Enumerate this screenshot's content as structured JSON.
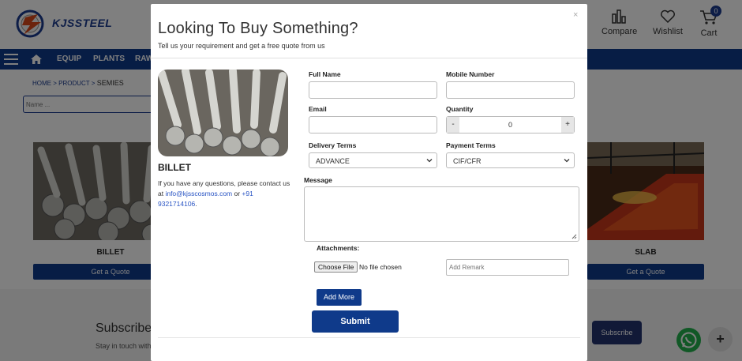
{
  "header": {
    "logo_text": "KJSSTEEL",
    "compare_label": "Compare",
    "wishlist_label": "Wishlist",
    "cart_label": "Cart",
    "cart_count": "0"
  },
  "nav": {
    "items": [
      "EQUIP",
      "PLANTS",
      "RAW"
    ]
  },
  "breadcrumb": {
    "home": "HOME",
    "product": "PRODUCT",
    "sep": ">",
    "current": "SEMIES"
  },
  "search": {
    "placeholder": "Name ..."
  },
  "products": [
    {
      "name": "BILLET",
      "cta": "Get a Quote"
    },
    {
      "name": "SLAB",
      "cta": "Get a Quote"
    }
  ],
  "footer": {
    "subscribe_title": "Subscribe",
    "subscribe_sub": "Stay in touch with",
    "subscribe_button": "Subscribe",
    "fab_plus": "+"
  },
  "modal": {
    "close": "×",
    "title": "Looking To Buy Something?",
    "subtitle": "Tell us your requirement and get a free quote from us",
    "product_name": "BILLET",
    "help_text_before": "If you have any questions, please contact us at ",
    "help_email": "info@kjsscosmos.com",
    "help_or": " or ",
    "help_phone": "+91 9321714106",
    "help_end": ".",
    "fields": {
      "full_name_label": "Full Name",
      "mobile_label": "Mobile Number",
      "email_label": "Email",
      "quantity_label": "Quantity",
      "quantity_value": "0",
      "qty_minus": "-",
      "qty_plus": "+",
      "delivery_label": "Delivery Terms",
      "delivery_value": "ADVANCE",
      "payment_label": "Payment Terms",
      "payment_value": "CIF/CFR",
      "message_label": "Message",
      "attachments_label": "Attachments:",
      "choose_file": "Choose File",
      "no_file": "No file chosen",
      "remark_placeholder": "Add Remark"
    },
    "add_more": "Add More",
    "submit": "Submit"
  }
}
